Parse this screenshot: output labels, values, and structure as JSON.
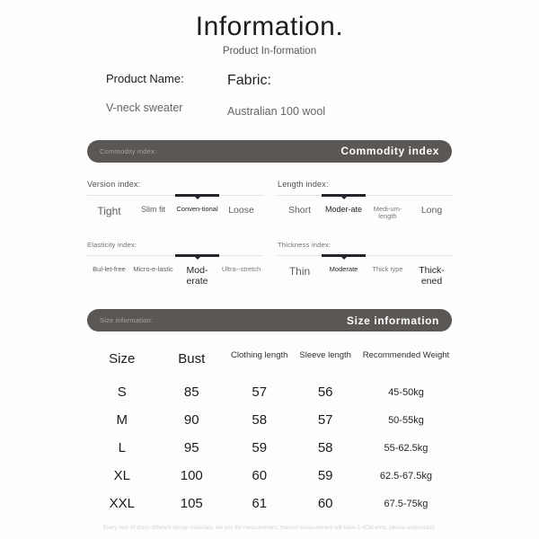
{
  "header": {
    "title": "Information.",
    "subtitle": "Product In-formation"
  },
  "product": {
    "name_label": "Product Name:",
    "name_value": "V-neck sweater",
    "fabric_label": "Fabric:",
    "fabric_value": "Australian 100 wool"
  },
  "commodity_banner": {
    "left_label": "Commodity index:",
    "right_label": "Commodity index"
  },
  "size_banner": {
    "left_label": "Size information:",
    "right_label": "Size information"
  },
  "indexes": [
    {
      "title": "Version index:",
      "selected": 2,
      "options": [
        "Tight",
        "Slim fit",
        "Conven-tional",
        "Loose"
      ]
    },
    {
      "title": "Length index:",
      "selected": 1,
      "options": [
        "Short",
        "Moder-ate",
        "Medi-um-length",
        "Long"
      ]
    },
    {
      "title": "Elasticity index:",
      "selected": 2,
      "options": [
        "Bul-let-free",
        "Micro-e-lastic",
        "Mod-erate",
        "Ultra--stretch"
      ]
    },
    {
      "title": "Thickness index:",
      "selected": 1,
      "options": [
        "Thin",
        "Moderate",
        "Thick type",
        "Thick-ened"
      ]
    }
  ],
  "size_table": {
    "headers": [
      "Size",
      "Bust",
      "Clothing length",
      "Sleeve length",
      "Recommended Weight"
    ],
    "rows": [
      [
        "S",
        "85",
        "57",
        "56",
        "45-50kg"
      ],
      [
        "M",
        "90",
        "58",
        "57",
        "50-55kg"
      ],
      [
        "L",
        "95",
        "59",
        "58",
        "55-62.5kg"
      ],
      [
        "XL",
        "100",
        "60",
        "59",
        "62.5-67.5kg"
      ],
      [
        "XXL",
        "105",
        "61",
        "60",
        "67.5-75kg"
      ]
    ]
  },
  "footer": {
    "note": "Every item of dress different design materials, we use tile measurement, manual measurement will have 2-4CM error, please understand."
  },
  "colors": {
    "banner_bg": "#5a5755",
    "page_bg": "#fdfdfd",
    "track_selected": "#22262a"
  }
}
